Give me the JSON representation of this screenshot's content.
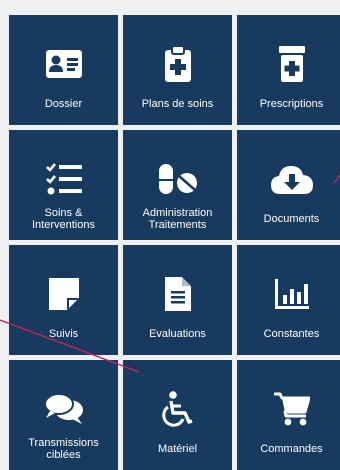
{
  "tiles": [
    {
      "label": "Dossier",
      "icon": "id-card-icon"
    },
    {
      "label": "Plans de soins",
      "icon": "clipboard-medical-icon"
    },
    {
      "label": "Prescriptions",
      "icon": "medicine-bottle-icon"
    },
    {
      "label": "Soins &\nInterventions",
      "icon": "task-list-icon"
    },
    {
      "label": "Administration\nTraitements",
      "icon": "pills-icon"
    },
    {
      "label": "Documents",
      "icon": "cloud-download-icon"
    },
    {
      "label": "Suivis",
      "icon": "sticky-note-icon"
    },
    {
      "label": "Evaluations",
      "icon": "document-icon"
    },
    {
      "label": "Constantes",
      "icon": "bar-chart-icon"
    },
    {
      "label": "Transmissions\nciblées",
      "icon": "chat-bubbles-icon"
    },
    {
      "label": "Matériel",
      "icon": "wheelchair-icon"
    },
    {
      "label": "Commandes",
      "icon": "shopping-cart-icon"
    }
  ],
  "colors": {
    "background": "#eef0f2",
    "tile": "#183a5e",
    "text": "#ffffff",
    "annotation": "#c2255c"
  }
}
